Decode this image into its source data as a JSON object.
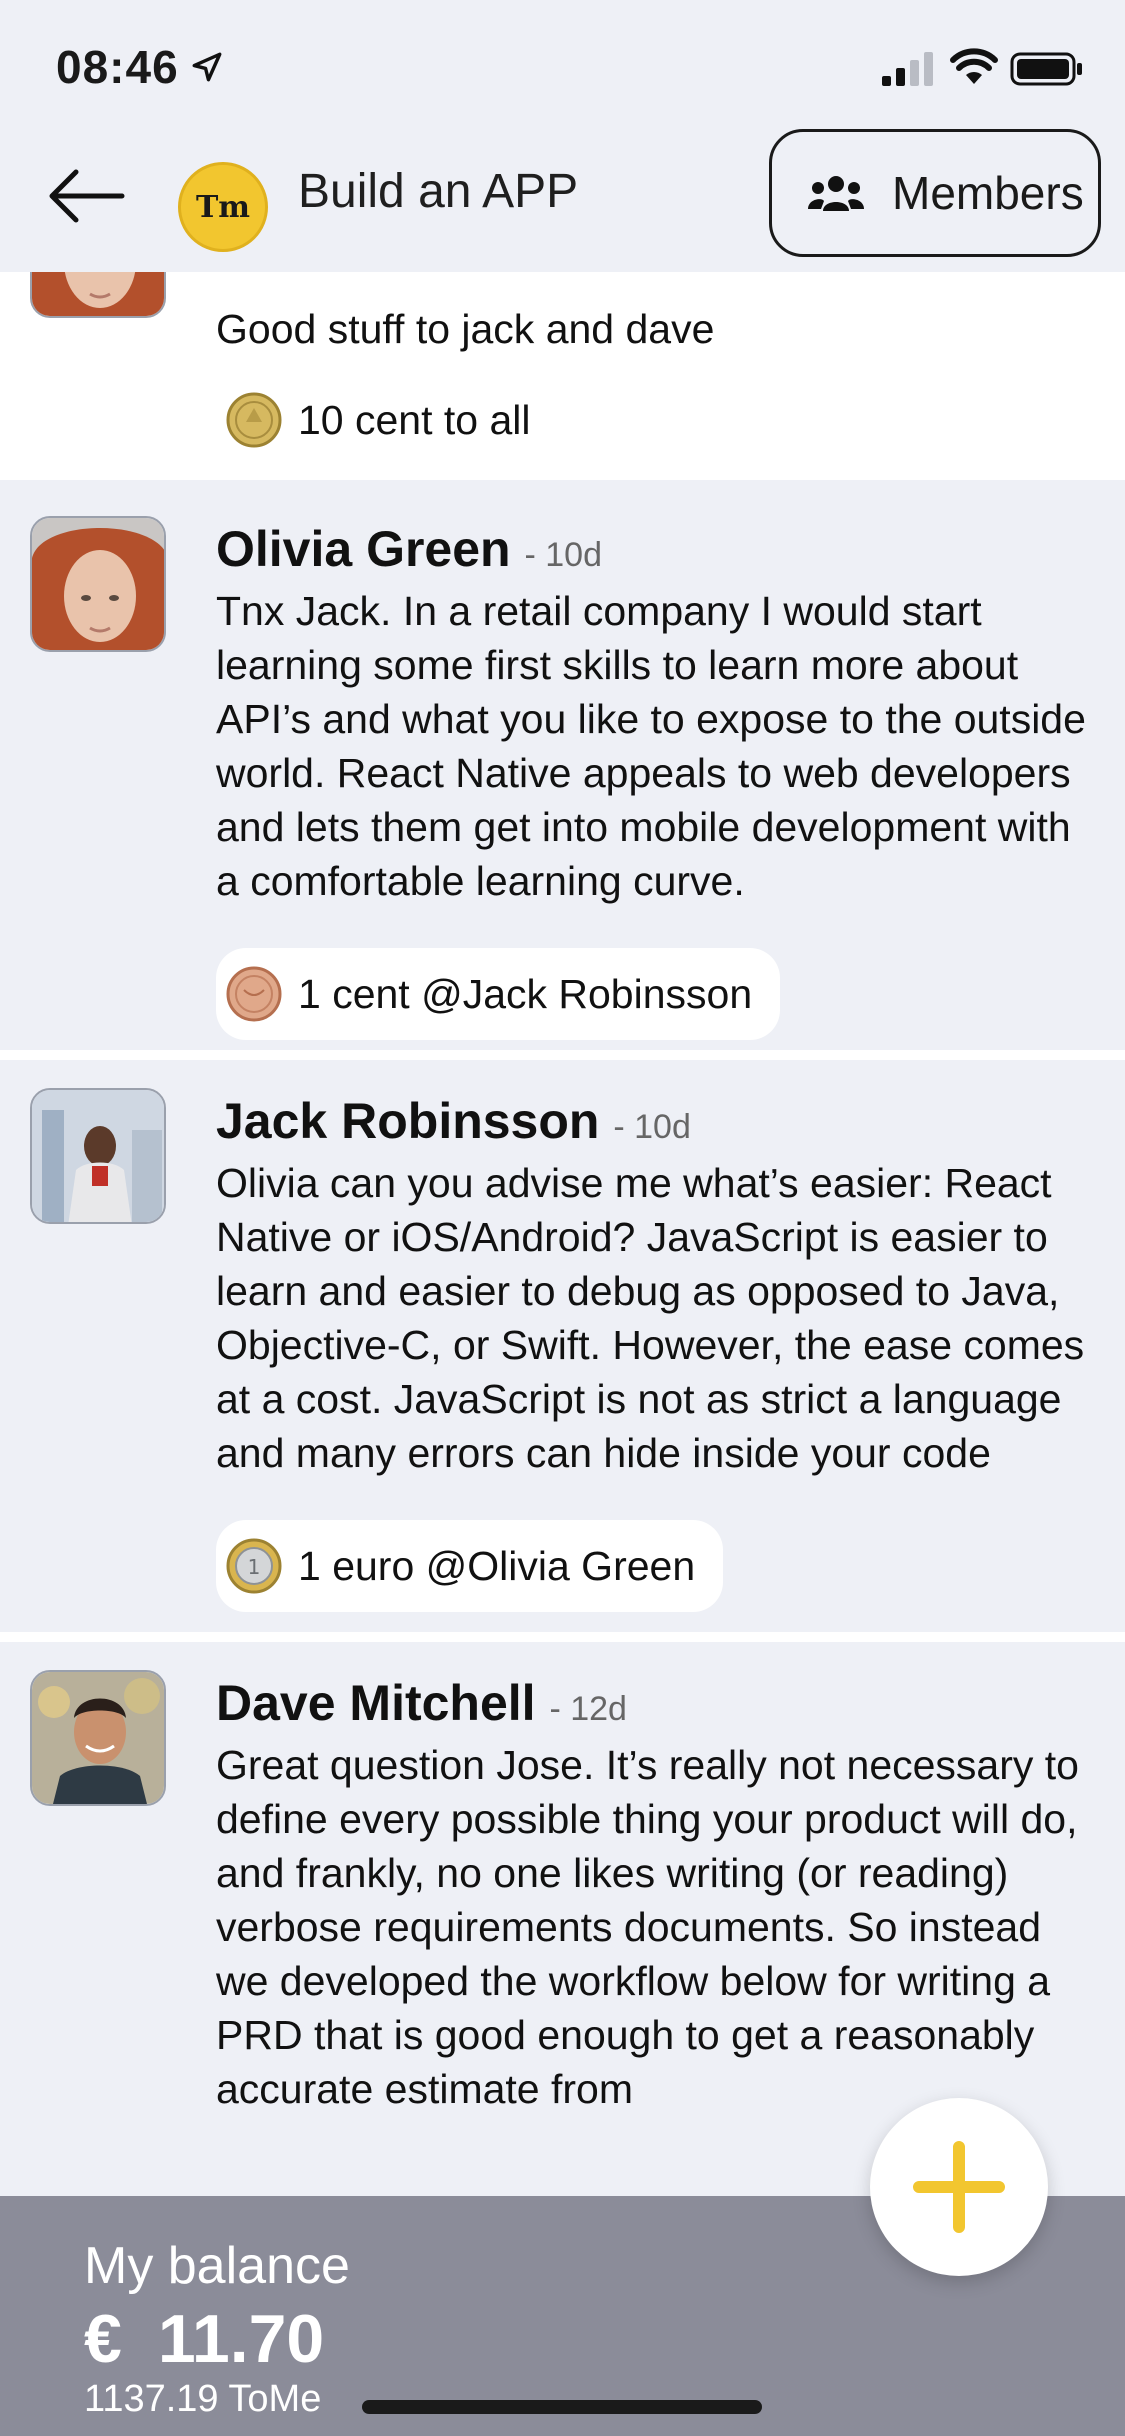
{
  "status_bar": {
    "time": "08:46"
  },
  "header": {
    "group_logo_text": "Tm",
    "title": "Build an APP",
    "members_label": "Members"
  },
  "posts": [
    {
      "author": "",
      "age": "",
      "message": "Good stuff to jack and dave",
      "tip": "10 cent to all",
      "coin": "10-cent-coin"
    },
    {
      "author": "Olivia Green",
      "age": "- 10d",
      "message": "Tnx Jack. In a retail company I would start learning some first skills to learn more about API’s and what you like to expose to the outside world. React Native appeals to web developers and lets them get into mobile development with a comfortable learning curve.",
      "tip": "1 cent @Jack Robinsson",
      "coin": "1-cent-coin"
    },
    {
      "author": "Jack Robinsson",
      "age": "- 10d",
      "message": "Olivia can you advise me what’s easier: React Native or iOS/Android? JavaScript is easier to learn and easier to debug as opposed to Java, Objective-C, or Swift. However, the ease comes at a cost. JavaScript is not as strict a language and many errors can hide inside your code",
      "tip": "1 euro @Olivia Green",
      "coin": "1-euro-coin"
    },
    {
      "author": "Dave Mitchell",
      "age": "- 12d",
      "message": "Great question Jose. It’s really not necessary to define every possible thing your product will do, and frankly, no one likes writing (or reading) verbose requirements documents. So instead we developed the workflow below for writing a PRD that is good enough to get a reasonably accurate estimate from",
      "tip": "",
      "coin": ""
    }
  ],
  "balance": {
    "title": "My balance",
    "currency": "€",
    "amount": "11.70",
    "tome": "1137.19 ToMe"
  },
  "colors": {
    "accent_yellow": "#f2c62f",
    "background": "#eef0f6",
    "balance_bar": "#8b8c99"
  }
}
